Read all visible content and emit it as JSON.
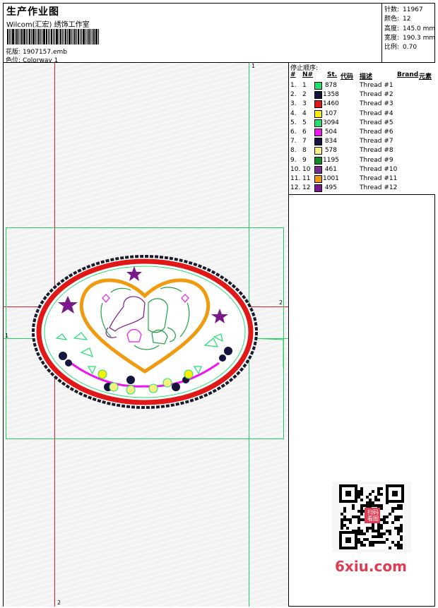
{
  "header": {
    "title": "生产作业图",
    "company": "Wilcom(汇宏) 绣饰工作室",
    "design_label": "花版:",
    "design_value": "1907157.emb",
    "colorway_label": "色位:",
    "colorway_value": "Colorway 1"
  },
  "stats": [
    {
      "label": "针数:",
      "value": "11967"
    },
    {
      "label": "颜色:",
      "value": "12"
    },
    {
      "label": "高度:",
      "value": "145.0 mm"
    },
    {
      "label": "宽度:",
      "value": "190.3 mm"
    },
    {
      "label": "比例:",
      "value": "0.70"
    }
  ],
  "stop_sequence": {
    "label": "停止顺序:",
    "headers": {
      "seq": "#",
      "no": "N#",
      "st": "St.",
      "code": "代码",
      "desc": "描述",
      "brand": "Brand",
      "elem": "元素"
    },
    "rows": [
      {
        "seq": "1.",
        "no": "1",
        "st": "878",
        "desc": "Thread #1",
        "color": "#22e070"
      },
      {
        "seq": "2.",
        "no": "2",
        "st": "1358",
        "desc": "Thread #2",
        "color": "#14143c"
      },
      {
        "seq": "3.",
        "no": "3",
        "st": "1460",
        "desc": "Thread #3",
        "color": "#e01818"
      },
      {
        "seq": "4.",
        "no": "4",
        "st": "107",
        "desc": "Thread #4",
        "color": "#f6f000"
      },
      {
        "seq": "5.",
        "no": "5",
        "st": "3094",
        "desc": "Thread #5",
        "color": "#22e070"
      },
      {
        "seq": "6.",
        "no": "6",
        "st": "504",
        "desc": "Thread #6",
        "color": "#ee18ee"
      },
      {
        "seq": "7.",
        "no": "7",
        "st": "834",
        "desc": "Thread #7",
        "color": "#14143c"
      },
      {
        "seq": "8.",
        "no": "8",
        "st": "578",
        "desc": "Thread #8",
        "color": "#f6f080"
      },
      {
        "seq": "9.",
        "no": "9",
        "st": "1195",
        "desc": "Thread #9",
        "color": "#128a2a"
      },
      {
        "seq": "10.",
        "no": "10",
        "st": "461",
        "desc": "Thread #10",
        "color": "#7a2a8a"
      },
      {
        "seq": "11.",
        "no": "11",
        "st": "1001",
        "desc": "Thread #11",
        "color": "#f09a10"
      },
      {
        "seq": "12.",
        "no": "12",
        "st": "495",
        "desc": "Thread #12",
        "color": "#7a1a8a"
      }
    ]
  },
  "guides": {
    "top_label": "1",
    "right_label": "2",
    "left_label": "1",
    "bottom_label": "2"
  },
  "watermark": {
    "text": "6xiu.com",
    "qr_badge": "扫码看图"
  }
}
